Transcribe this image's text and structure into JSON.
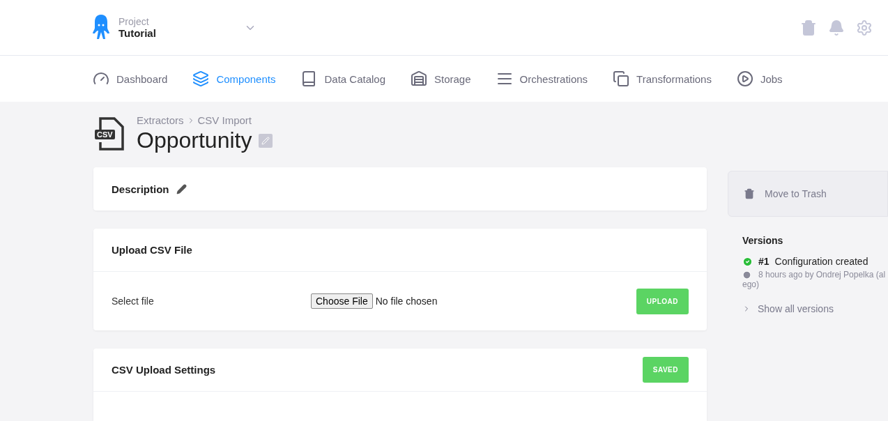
{
  "project": {
    "label": "Project",
    "name": "Tutorial"
  },
  "nav": [
    {
      "label": "Dashboard",
      "selected": false
    },
    {
      "label": "Components",
      "selected": true
    },
    {
      "label": "Data Catalog",
      "selected": false
    },
    {
      "label": "Storage",
      "selected": false
    },
    {
      "label": "Orchestrations",
      "selected": false
    },
    {
      "label": "Transformations",
      "selected": false
    },
    {
      "label": "Jobs",
      "selected": false
    }
  ],
  "breadcrumbs": [
    "Extractors",
    "CSV Import"
  ],
  "title": "Opportunity",
  "logo_text": "CSV",
  "description": {
    "title": "Description"
  },
  "upload": {
    "title": "Upload CSV File",
    "field_label": "Select file",
    "file_button": "Choose File",
    "file_status": "No file chosen",
    "button": "UPLOAD"
  },
  "settings": {
    "title": "CSV Upload Settings",
    "button": "SAVED"
  },
  "sidebar": {
    "trash": "Move to Trash",
    "versions_title": "Versions",
    "versions": [
      {
        "number": "#1",
        "text": "Configuration created",
        "meta_lines": [
          "8 hours ago by Ondrej Popelka (al",
          "ego)"
        ]
      }
    ],
    "show_all": "Show all versions"
  }
}
